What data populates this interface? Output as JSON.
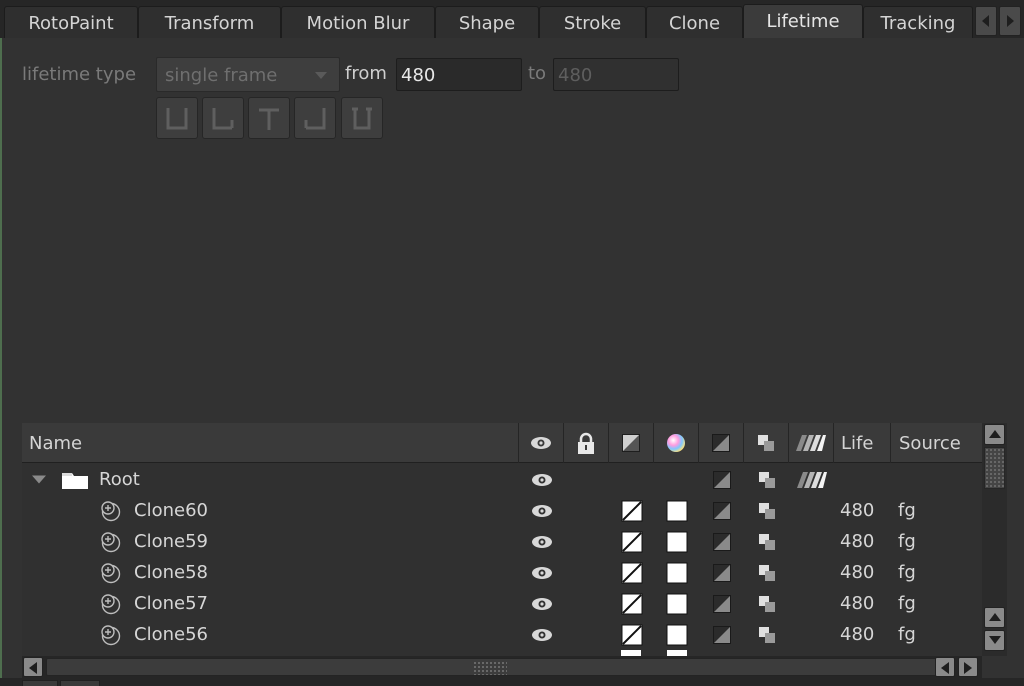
{
  "tabs": [
    {
      "label": "RotoPaint",
      "active": false
    },
    {
      "label": "Transform",
      "active": false
    },
    {
      "label": "Motion Blur",
      "active": false
    },
    {
      "label": "Shape",
      "active": false
    },
    {
      "label": "Stroke",
      "active": false
    },
    {
      "label": "Clone",
      "active": false
    },
    {
      "label": "Lifetime",
      "active": true
    },
    {
      "label": "Tracking",
      "active": false
    }
  ],
  "lifetime": {
    "type_label": "lifetime type",
    "type_value": "single frame",
    "from_label": "from",
    "from_value": "480",
    "to_label": "to",
    "to_value": "480",
    "buttons": [
      "all-frames-icon",
      "start-to-frame-icon",
      "single-frame-icon",
      "frame-to-end-icon",
      "frame-range-icon"
    ]
  },
  "table": {
    "columns": {
      "name": "Name",
      "visible": "eye-icon",
      "locked": "lock-icon",
      "invert": "invert-icon",
      "color": "color-wheel-icon",
      "blending": "blend-icon",
      "overlay": "overlay-icon",
      "motion_blur": "motion-blur-icon",
      "life": "Life",
      "source": "Source"
    },
    "root": {
      "label": "Root",
      "expanded": true
    },
    "rows": [
      {
        "name": "Clone60",
        "life": "480",
        "source": "fg"
      },
      {
        "name": "Clone59",
        "life": "480",
        "source": "fg"
      },
      {
        "name": "Clone58",
        "life": "480",
        "source": "fg"
      },
      {
        "name": "Clone57",
        "life": "480",
        "source": "fg"
      },
      {
        "name": "Clone56",
        "life": "480",
        "source": "fg"
      }
    ]
  },
  "colors": {
    "background": "#323232",
    "tab_active": "#3b3b3b",
    "header": "#3a3a3a"
  }
}
